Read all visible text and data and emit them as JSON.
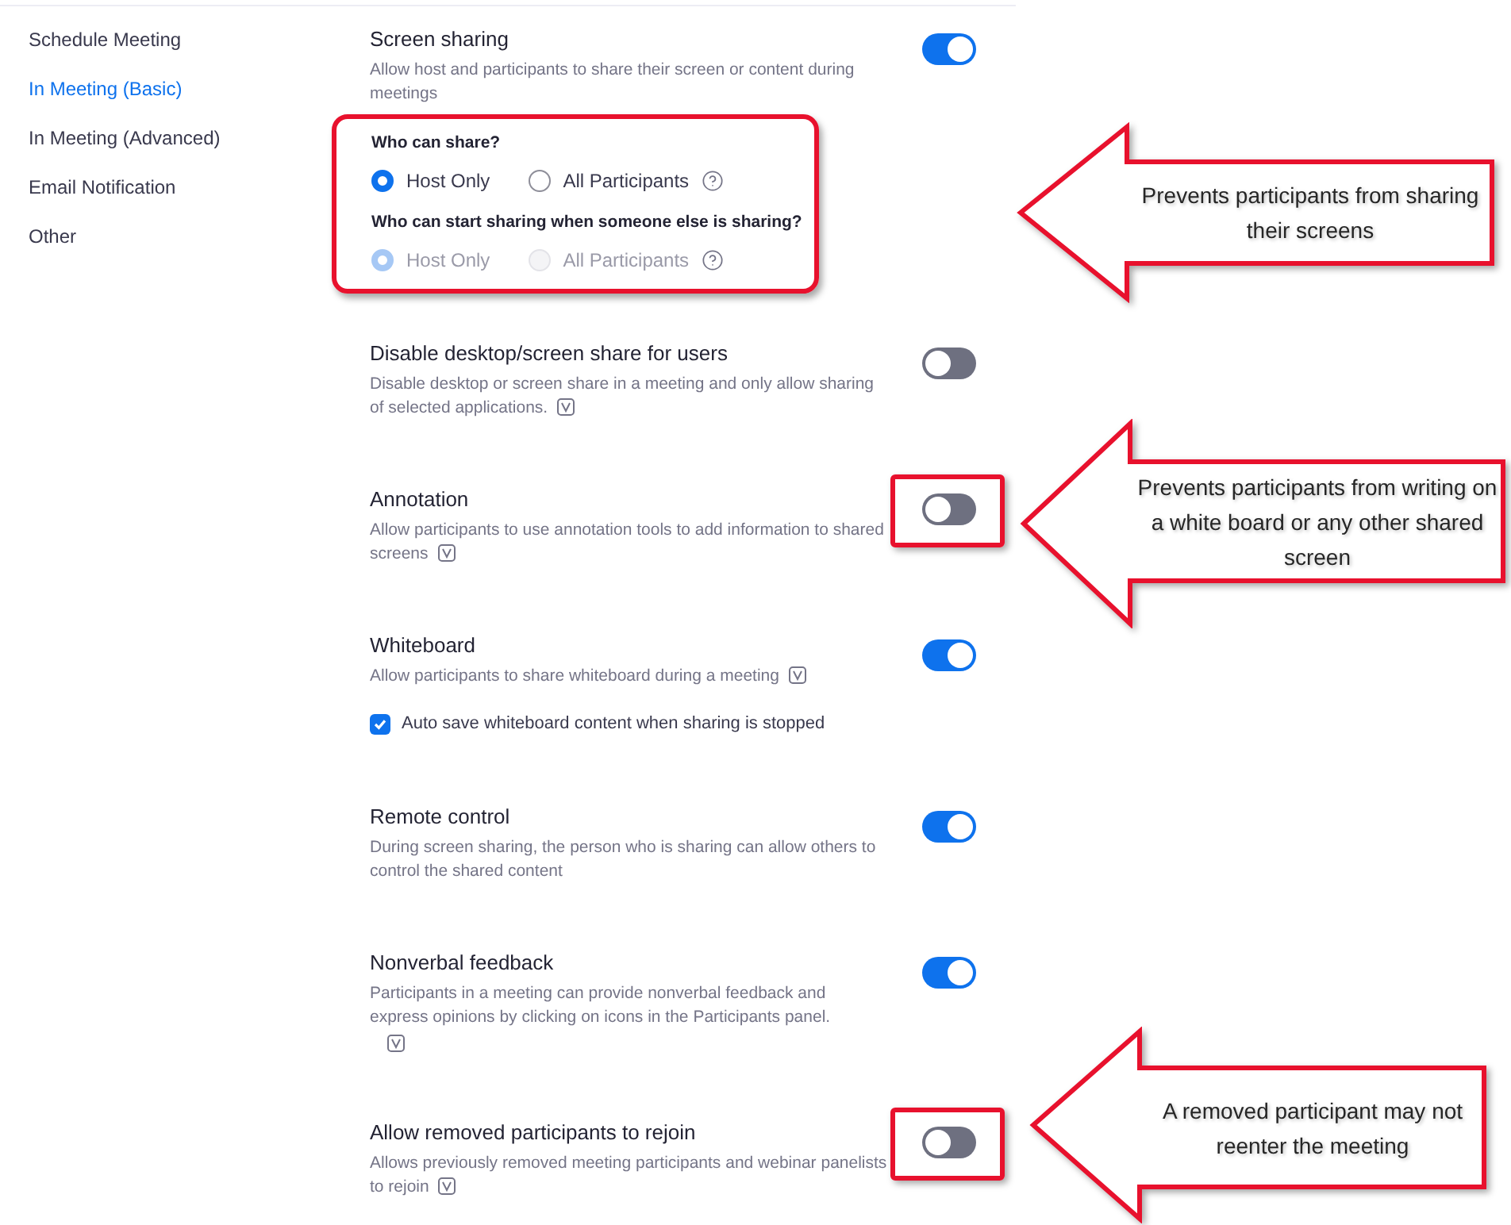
{
  "sidebar": {
    "items": [
      {
        "label": "Schedule Meeting",
        "selected": false
      },
      {
        "label": "In Meeting (Basic)",
        "selected": true
      },
      {
        "label": "In Meeting (Advanced)",
        "selected": false
      },
      {
        "label": "Email Notification",
        "selected": false
      },
      {
        "label": "Other",
        "selected": false
      }
    ]
  },
  "settings": [
    {
      "title": "Screen sharing",
      "description": "Allow host and participants to share their screen or content during meetings",
      "on": true,
      "version_icon": false,
      "highlighted": false,
      "sharing_options": {
        "highlighted": true,
        "groups": [
          {
            "question": "Who can share?",
            "disabled": false,
            "options": [
              {
                "label": "Host Only",
                "selected": true
              },
              {
                "label": "All Participants",
                "selected": false
              }
            ]
          },
          {
            "question": "Who can start sharing when someone else is sharing?",
            "disabled": true,
            "options": [
              {
                "label": "Host Only",
                "selected": true
              },
              {
                "label": "All Participants",
                "selected": false
              }
            ]
          }
        ]
      }
    },
    {
      "title": "Disable desktop/screen share for users",
      "description": "Disable desktop or screen share in a meeting and only allow sharing of selected applications.",
      "on": false,
      "version_icon": true,
      "highlighted": false
    },
    {
      "title": "Annotation",
      "description": "Allow participants to use annotation tools to add information to shared screens",
      "on": false,
      "version_icon": true,
      "highlighted": true
    },
    {
      "title": "Whiteboard",
      "description": "Allow participants to share whiteboard during a meeting",
      "on": true,
      "version_icon": true,
      "highlighted": false,
      "checkbox": {
        "label": "Auto save whiteboard content when sharing is stopped",
        "checked": true
      }
    },
    {
      "title": "Remote control",
      "description": "During screen sharing, the person who is sharing can allow others to control the shared content",
      "on": true,
      "version_icon": false,
      "highlighted": false
    },
    {
      "title": "Nonverbal feedback",
      "description": "Participants in a meeting can provide nonverbal feedback and express opinions by clicking on icons in the Participants panel.",
      "on": true,
      "version_icon": true,
      "icon_on_new_line": true,
      "highlighted": false
    },
    {
      "title": "Allow removed participants to rejoin",
      "description": "Allows previously removed meeting participants and webinar panelists to rejoin",
      "on": false,
      "version_icon": true,
      "highlighted": true
    }
  ],
  "callouts": [
    {
      "text": "Prevents participants from sharing their screens"
    },
    {
      "text": "Prevents participants from writing on a white board or any other shared screen"
    },
    {
      "text": "A removed participant may not reenter the meeting"
    }
  ]
}
